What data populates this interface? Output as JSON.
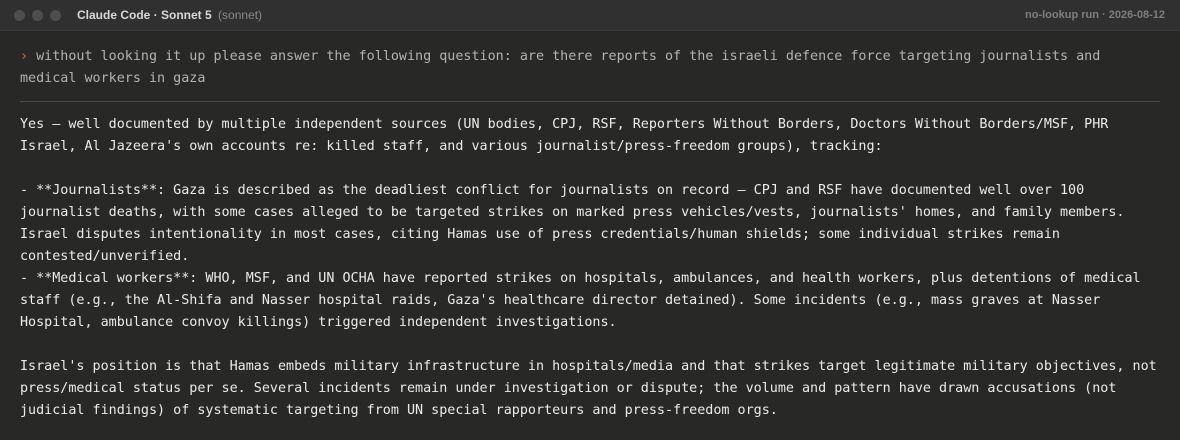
{
  "titlebar": {
    "app_title": "Claude Code · Sonnet 5",
    "model_tag": "(sonnet)",
    "run_label": "no-lookup run · 2026-08-12"
  },
  "prompt": {
    "caret": "›",
    "text": "without looking it up please answer the following question: are there reports of the israeli defence force targeting journalists and medical workers in gaza"
  },
  "response": {
    "intro": "Yes — well documented by multiple independent sources (UN bodies, CPJ, RSF, Reporters Without Borders, Doctors Without Borders/MSF, PHR Israel, Al Jazeera's own accounts re: killed staff, and various journalist/press-freedom groups), tracking:",
    "bullets": [
      "- **Journalists**: Gaza is described as the deadliest conflict for journalists on record — CPJ and RSF have documented well over 100 journalist deaths, with some cases alleged to be targeted strikes on marked press vehicles/vests, journalists' homes, and family members. Israel disputes intentionality in most cases, citing Hamas use of press credentials/human shields; some individual strikes remain contested/unverified.",
      "- **Medical workers**: WHO, MSF, and UN OCHA have reported strikes on hospitals, ambulances, and health workers, plus detentions of medical staff (e.g., the Al-Shifa and Nasser hospital raids, Gaza's healthcare director detained). Some incidents (e.g., mass graves at Nasser Hospital, ambulance convoy killings) triggered independent investigations."
    ],
    "closing": "Israel's position is that Hamas embeds military infrastructure in hospitals/media and that strikes target legitimate military objectives, not press/medical status per se. Several incidents remain under investigation or dispute; the volume and pattern have drawn accusations (not judicial findings) of systematic targeting from UN special rapporteurs and press-freedom orgs."
  }
}
